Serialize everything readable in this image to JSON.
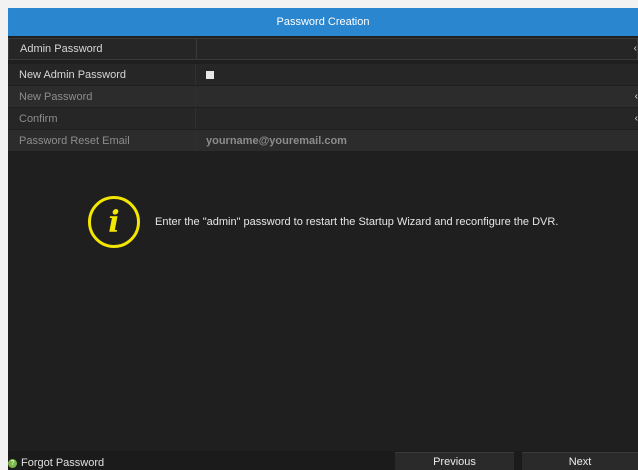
{
  "window": {
    "title": "Password Creation"
  },
  "form": {
    "admin_password": {
      "label": "Admin Password",
      "value": ""
    },
    "new_admin_password": {
      "label": "New Admin Password",
      "checked": true
    },
    "new_password": {
      "label": "New Password",
      "value": ""
    },
    "confirm": {
      "label": "Confirm",
      "value": ""
    },
    "reset_email": {
      "label": "Password Reset Email",
      "value": "yourname@youremail.com"
    }
  },
  "info": {
    "icon": "info-icon",
    "glyph": "i",
    "message": "Enter the \"admin\" password to restart the Startup Wizard and reconfigure the DVR."
  },
  "footer": {
    "forgot_label": "Forgot Password",
    "forgot_icon": "help-icon",
    "forgot_glyph": "?",
    "previous_label": "Previous",
    "next_label": "Next"
  },
  "colors": {
    "title_bar": "#2a86cf",
    "info_accent": "#f3e600",
    "help_icon": "#7ab648"
  }
}
